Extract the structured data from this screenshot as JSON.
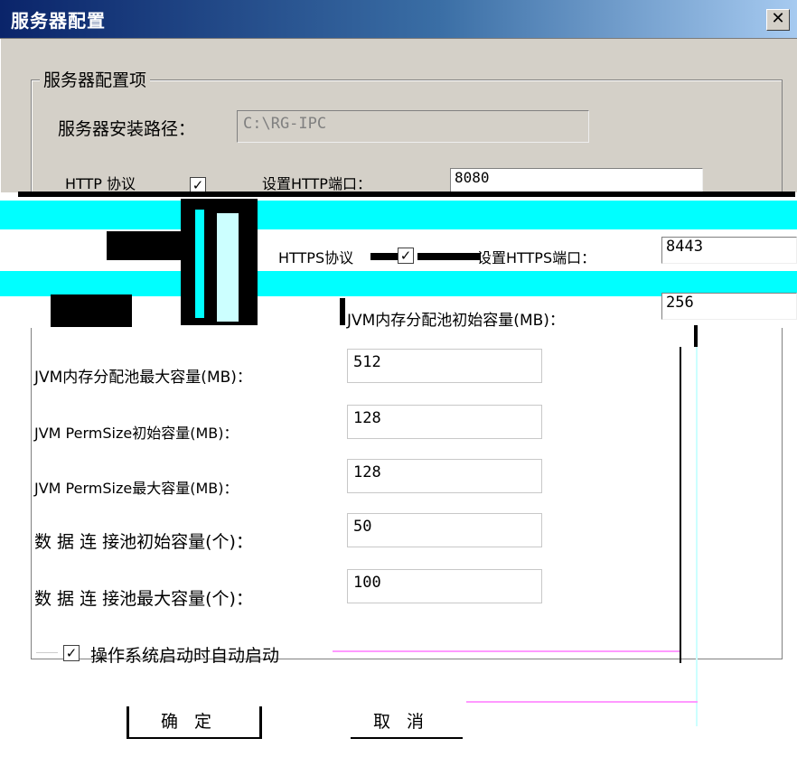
{
  "window": {
    "title": "服务器配置",
    "close_glyph": "✕"
  },
  "group": {
    "label": "服务器配置项"
  },
  "install_path": {
    "label": "服务器安装路径：",
    "value": "C:\\RG-IPC"
  },
  "http": {
    "label": "HTTP 协议",
    "port_label": "设置HTTP端口：",
    "port": "8080",
    "checked": true
  },
  "https": {
    "label": "HTTPS协议",
    "port_label": "设置HTTPS端口：",
    "port": "8443",
    "checked": true
  },
  "jvm": {
    "init_label": "JVM内存分配池初始容量(MB)：",
    "init_value": "256",
    "max_label": "JVM内存分配池最大容量(MB)：",
    "max_value": "512",
    "perm_init_label": "JVM  PermSize初始容量(MB)：",
    "perm_init_value": "128",
    "perm_max_label": "JVM  PermSize最大容量(MB)：",
    "perm_max_value": "128"
  },
  "db_pool": {
    "init_label": "数 据 连 接池初始容量(个)：",
    "init_value": "50",
    "max_label": "数 据 连 接池最大容量(个)：",
    "max_value": "100"
  },
  "autostart": {
    "label": "操作系统启动时自动启动",
    "checked": true,
    "check_glyph": "✓"
  },
  "buttons": {
    "ok": "确定",
    "cancel": "取消"
  }
}
